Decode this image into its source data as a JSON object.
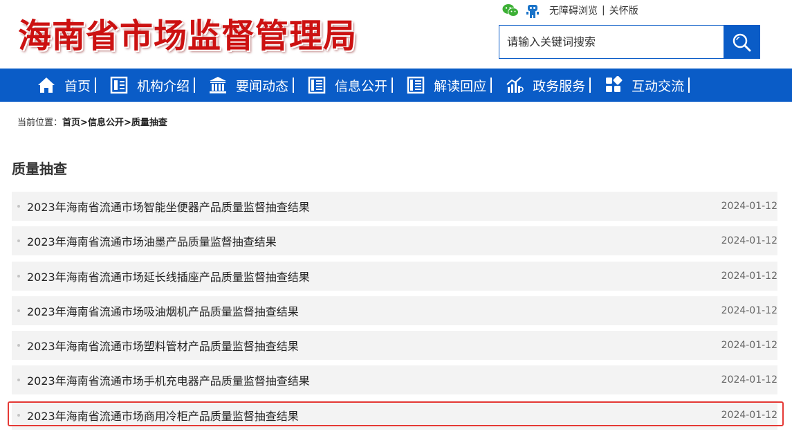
{
  "header": {
    "site_title": "海南省市场监督管理局",
    "top_links": {
      "accessibility": "无障碍浏览",
      "separator": "|",
      "care_mode": "关怀版"
    },
    "search": {
      "placeholder": "请输入关键词搜索"
    }
  },
  "nav": {
    "items": [
      {
        "label": "首页",
        "icon": "home-icon"
      },
      {
        "label": "机构介绍",
        "icon": "document-icon"
      },
      {
        "label": "要闻动态",
        "icon": "building-icon"
      },
      {
        "label": "信息公开",
        "icon": "list-icon"
      },
      {
        "label": "解读回应",
        "icon": "book-icon"
      },
      {
        "label": "政务服务",
        "icon": "chart-icon"
      },
      {
        "label": "互动交流",
        "icon": "grid-icon"
      }
    ]
  },
  "breadcrumb": {
    "prefix": "当前位置：",
    "home": "首页",
    "arrow": ">",
    "section": "信息公开",
    "current": "质量抽查"
  },
  "page_title": "质量抽查",
  "list": {
    "items": [
      {
        "title": "2023年海南省流通市场智能坐便器产品质量监督抽查结果",
        "date": "2024-01-12"
      },
      {
        "title": "2023年海南省流通市场油墨产品质量监督抽查结果",
        "date": "2024-01-12"
      },
      {
        "title": "2023年海南省流通市场延长线插座产品质量监督抽查结果",
        "date": "2024-01-12"
      },
      {
        "title": "2023年海南省流通市场吸油烟机产品质量监督抽查结果",
        "date": "2024-01-12"
      },
      {
        "title": "2023年海南省流通市场塑料管材产品质量监督抽查结果",
        "date": "2024-01-12"
      },
      {
        "title": "2023年海南省流通市场手机充电器产品质量监督抽查结果",
        "date": "2024-01-12"
      },
      {
        "title": "2023年海南省流通市场商用冷柜产品质量监督抽查结果",
        "date": "2024-01-12"
      }
    ]
  },
  "colors": {
    "brand_blue": "#0a5cc7",
    "title_red": "#cc1111",
    "highlight_red": "#e53935"
  }
}
